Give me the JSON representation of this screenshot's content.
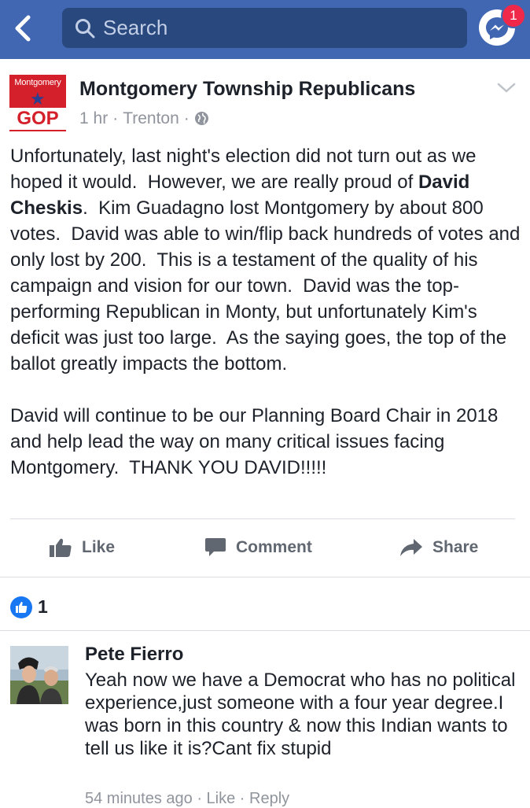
{
  "header": {
    "search_placeholder": "Search",
    "messenger_badge": "1",
    "icons": [
      "back-arrow-icon",
      "search-icon",
      "messenger-icon"
    ]
  },
  "post": {
    "page_name": "Montgomery Township Republicans",
    "logo": {
      "top_text": "Montgomery",
      "bottom_text": "GOP"
    },
    "time": "1 hr",
    "location": "Trenton",
    "sep": "·",
    "paragraph1_a": "Unfortunately, last night's election did not turn out as we hoped it would.  However, we are really proud of ",
    "paragraph1_bold": "David Cheskis",
    "paragraph1_b": ".  Kim Guadagno lost Montgomery by about 800 votes.  David was able to win/flip back hundreds of votes and only lost by 200.  This is a testament of the quality of his campaign and vision for our town.  David was the top-performing Republican in Monty, but unfortunately Kim's deficit was just too large.  As the saying goes, the top of the ballot greatly impacts the bottom.",
    "paragraph2": "David will continue to be our Planning Board Chair in 2018 and help lead the way on many critical issues facing Montgomery.  THANK YOU DAVID!!!!!"
  },
  "actions": {
    "like": "Like",
    "comment": "Comment",
    "share": "Share"
  },
  "reactions": {
    "count": "1"
  },
  "comment": {
    "author": "Pete Fierro",
    "text": "Yeah now we have a Democrat who has no political experience,just someone with a four year degree.I was born in this country & now this Indian wants to tell us like it is?Cant fix stupid",
    "time": "54 minutes ago",
    "like": "Like",
    "reply": "Reply"
  },
  "colors": {
    "brand": "#4267b2",
    "search_bg": "#29487d",
    "badge": "#f02849",
    "logo_red": "#d4202a",
    "like_blue": "#1877f2"
  }
}
